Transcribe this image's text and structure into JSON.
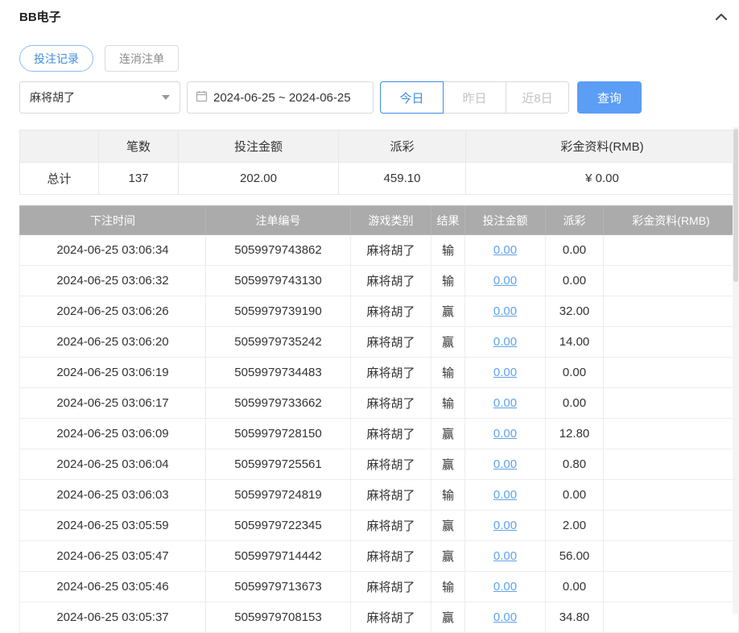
{
  "header": {
    "title": "BB电子"
  },
  "tabs": [
    {
      "label": "投注记录",
      "active": true
    },
    {
      "label": "连消注单",
      "active": false
    }
  ],
  "filters": {
    "game_select_value": "麻将胡了",
    "date_range_value": "2024-06-25 ~ 2024-06-25",
    "quick_ranges": [
      {
        "label": "今日",
        "active": true
      },
      {
        "label": "昨日",
        "active": false
      },
      {
        "label": "近8日",
        "active": false
      }
    ],
    "search_button_label": "查询"
  },
  "summary_table": {
    "headers": [
      "",
      "笔数",
      "投注金额",
      "派彩",
      "彩金资料(RMB)"
    ],
    "total_row": {
      "label": "总计",
      "count": "137",
      "bet_amount": "202.00",
      "payout": "459.10",
      "bonus": "¥ 0.00"
    }
  },
  "bet_table": {
    "headers": [
      "下注时间",
      "注单编号",
      "游戏类别",
      "结果",
      "投注金额",
      "派彩",
      "彩金资料(RMB)"
    ],
    "rows": [
      {
        "time": "2024-06-25 03:06:34",
        "order_id": "5059979743862",
        "game": "麻将胡了",
        "result": "输",
        "bet": "0.00",
        "payout": "0.00",
        "bonus": ""
      },
      {
        "time": "2024-06-25 03:06:32",
        "order_id": "5059979743130",
        "game": "麻将胡了",
        "result": "输",
        "bet": "0.00",
        "payout": "0.00",
        "bonus": ""
      },
      {
        "time": "2024-06-25 03:06:26",
        "order_id": "5059979739190",
        "game": "麻将胡了",
        "result": "赢",
        "bet": "0.00",
        "payout": "32.00",
        "bonus": ""
      },
      {
        "time": "2024-06-25 03:06:20",
        "order_id": "5059979735242",
        "game": "麻将胡了",
        "result": "赢",
        "bet": "0.00",
        "payout": "14.00",
        "bonus": ""
      },
      {
        "time": "2024-06-25 03:06:19",
        "order_id": "5059979734483",
        "game": "麻将胡了",
        "result": "输",
        "bet": "0.00",
        "payout": "0.00",
        "bonus": ""
      },
      {
        "time": "2024-06-25 03:06:17",
        "order_id": "5059979733662",
        "game": "麻将胡了",
        "result": "输",
        "bet": "0.00",
        "payout": "0.00",
        "bonus": ""
      },
      {
        "time": "2024-06-25 03:06:09",
        "order_id": "5059979728150",
        "game": "麻将胡了",
        "result": "赢",
        "bet": "0.00",
        "payout": "12.80",
        "bonus": ""
      },
      {
        "time": "2024-06-25 03:06:04",
        "order_id": "5059979725561",
        "game": "麻将胡了",
        "result": "赢",
        "bet": "0.00",
        "payout": "0.80",
        "bonus": ""
      },
      {
        "time": "2024-06-25 03:06:03",
        "order_id": "5059979724819",
        "game": "麻将胡了",
        "result": "输",
        "bet": "0.00",
        "payout": "0.00",
        "bonus": ""
      },
      {
        "time": "2024-06-25 03:05:59",
        "order_id": "5059979722345",
        "game": "麻将胡了",
        "result": "赢",
        "bet": "0.00",
        "payout": "2.00",
        "bonus": ""
      },
      {
        "time": "2024-06-25 03:05:47",
        "order_id": "5059979714442",
        "game": "麻将胡了",
        "result": "赢",
        "bet": "0.00",
        "payout": "56.00",
        "bonus": ""
      },
      {
        "time": "2024-06-25 03:05:46",
        "order_id": "5059979713673",
        "game": "麻将胡了",
        "result": "输",
        "bet": "0.00",
        "payout": "0.00",
        "bonus": ""
      },
      {
        "time": "2024-06-25 03:05:37",
        "order_id": "5059979708153",
        "game": "麻将胡了",
        "result": "赢",
        "bet": "0.00",
        "payout": "34.80",
        "bonus": ""
      }
    ]
  },
  "colors": {
    "accent_blue": "#3f8de2",
    "search_button_blue": "#5c9df5",
    "table_header_gray": "#ababab",
    "link_blue": "#5fa3e8"
  }
}
